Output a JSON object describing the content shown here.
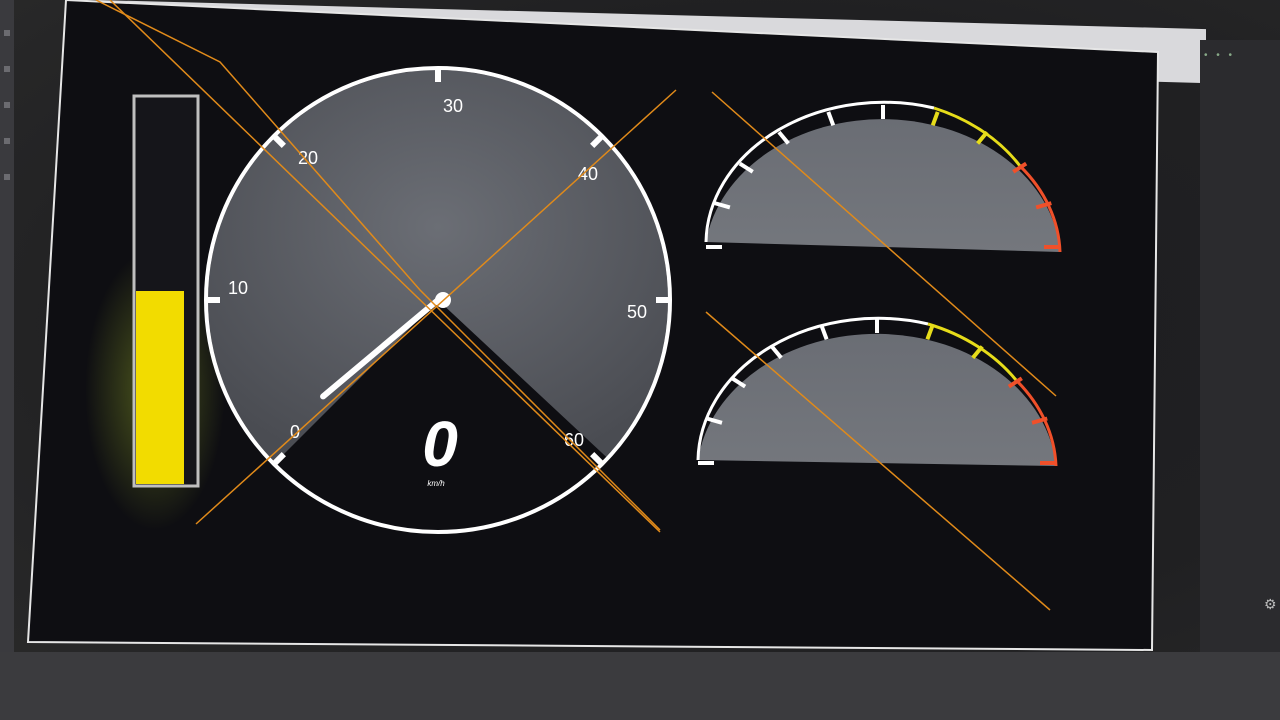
{
  "speedometer": {
    "tick_labels": [
      "0",
      "10",
      "20",
      "30",
      "40",
      "50",
      "60"
    ],
    "value": 0,
    "value_text": "0",
    "unit": "km/h"
  },
  "level_bar": {
    "fill_fraction": 0.5,
    "fill_color": "#f2dc00"
  },
  "half_gauge_top": {
    "ticks": 10,
    "zones": [
      "white",
      "yellow",
      "red"
    ]
  },
  "half_gauge_bottom": {
    "ticks": 10,
    "zones": [
      "white",
      "yellow",
      "red"
    ]
  },
  "colors": {
    "dial_face": "#5e6066",
    "dial_border": "#ffffff",
    "overlay_line": "#e08a1a",
    "yellow_zone": "#e6dc1a",
    "red_zone": "#f0502a"
  }
}
